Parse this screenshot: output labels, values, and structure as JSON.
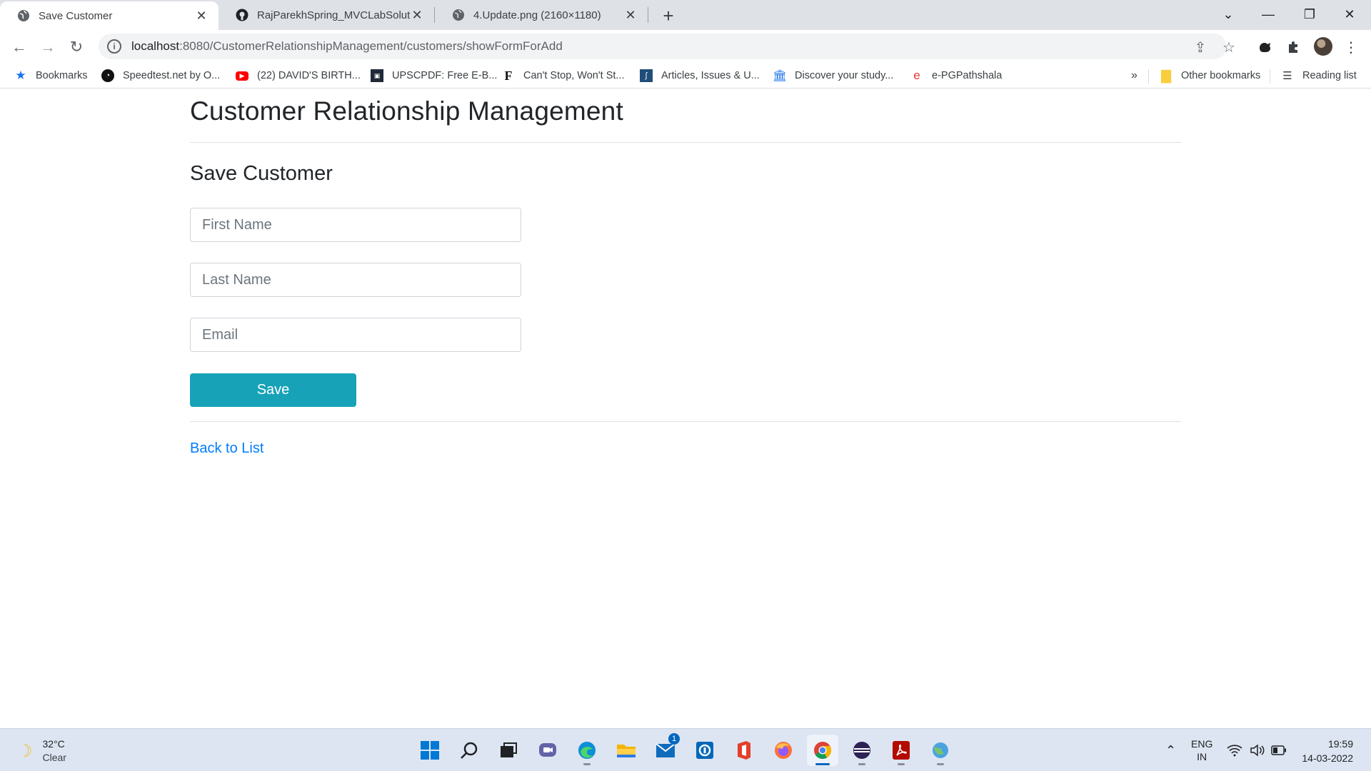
{
  "browser": {
    "tabs": [
      {
        "title": "Save Customer",
        "active": true
      },
      {
        "title": "RajParekhSpring_MVCLabSolution",
        "active": false
      },
      {
        "title": "4.Update.png (2160×1180)",
        "active": false
      }
    ],
    "new_tab_label": "+",
    "address": {
      "host": "localhost",
      "rest": ":8080/CustomerRelationshipManagement/customers/showFormForAdd"
    }
  },
  "bookmarks": {
    "items": [
      {
        "label": "Bookmarks"
      },
      {
        "label": "Speedtest.net by O..."
      },
      {
        "label": "(22) DAVID'S BIRTH..."
      },
      {
        "label": "UPSCPDF: Free E-B..."
      },
      {
        "label": "Can't Stop, Won't St..."
      },
      {
        "label": "Articles, Issues & U..."
      },
      {
        "label": "Discover your study..."
      },
      {
        "label": "e-PGPathshala"
      }
    ],
    "overflow": "»",
    "other": "Other bookmarks",
    "reading_list": "Reading list"
  },
  "page": {
    "title": "Customer Relationship Management",
    "form_title": "Save Customer",
    "fields": [
      {
        "placeholder": "First Name",
        "value": ""
      },
      {
        "placeholder": "Last Name",
        "value": ""
      },
      {
        "placeholder": "Email",
        "value": ""
      }
    ],
    "save_label": "Save",
    "back_link": "Back to List",
    "colors": {
      "button": "#17a2b8",
      "link": "#007bff"
    }
  },
  "taskbar": {
    "weather": {
      "temp": "32°C",
      "condition": "Clear"
    },
    "mail_badge": "1",
    "language": {
      "line1": "ENG",
      "line2": "IN"
    },
    "clock": {
      "time": "19:59",
      "date": "14-03-2022"
    }
  }
}
